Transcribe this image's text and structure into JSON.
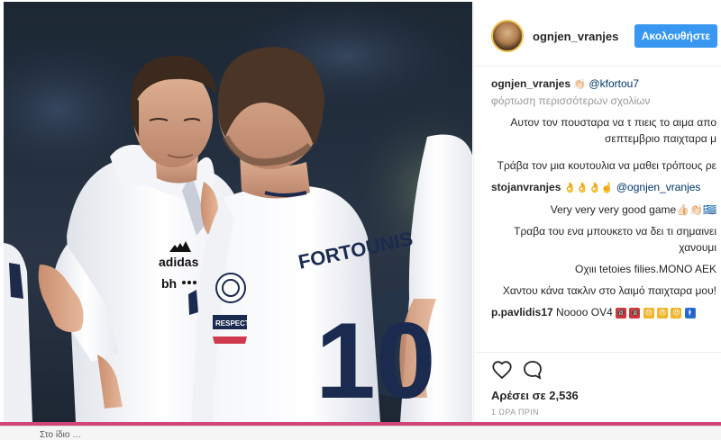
{
  "post": {
    "username": "ognjen_vranjes",
    "follow_label": "Ακολουθήστε",
    "likes": "Αρέσει σε 2,536",
    "time": "1 ΩΡΑ ΠΡΙΝ"
  },
  "caption": {
    "user": "ognjen_vranjes",
    "emoji": "👏🏻",
    "mention": "@kfortou7"
  },
  "load_more": "φόρτωση περισσότερων σχολίων",
  "comments": [
    {
      "text": "Αυτον τον πουσταρα να τ πιεις το αιμα απο σεπτεμβριο παιχταρα μ"
    },
    {
      "text": "Τράβα τον μια κουτουλια να μαθει τρόπους ρε"
    },
    {
      "user": "stojanvranjes",
      "emoji": "👌👌👌☝️",
      "mention": "@ognjen_vranjes"
    },
    {
      "text": "Very very very good game👍🏻👏🏻🇬🇷"
    },
    {
      "text": "Τραβα του ενα μπουκετο να δει τι σημαινει χανουμι"
    },
    {
      "text": "Οχιιι tetoies filies.ΜΟΝΟ ΑΕΚ"
    },
    {
      "text": "Χαντου κάνα τακλιν στο λαιμό παιχταρα μου!"
    },
    {
      "user": "p.pavlidis17",
      "text": "Noooo OV4"
    }
  ],
  "pavlidis_badges": [
    "🔞",
    "🔞",
    "😠",
    "😠",
    "😠",
    "🚹"
  ],
  "icons": {
    "like": "heart-outline-icon",
    "comment": "speech-bubble-icon"
  },
  "colors": {
    "follow": "#3897f0",
    "pink_bar": "#d1457a",
    "mention": "#003569"
  },
  "bottom_text": "Στο ίδιο …"
}
